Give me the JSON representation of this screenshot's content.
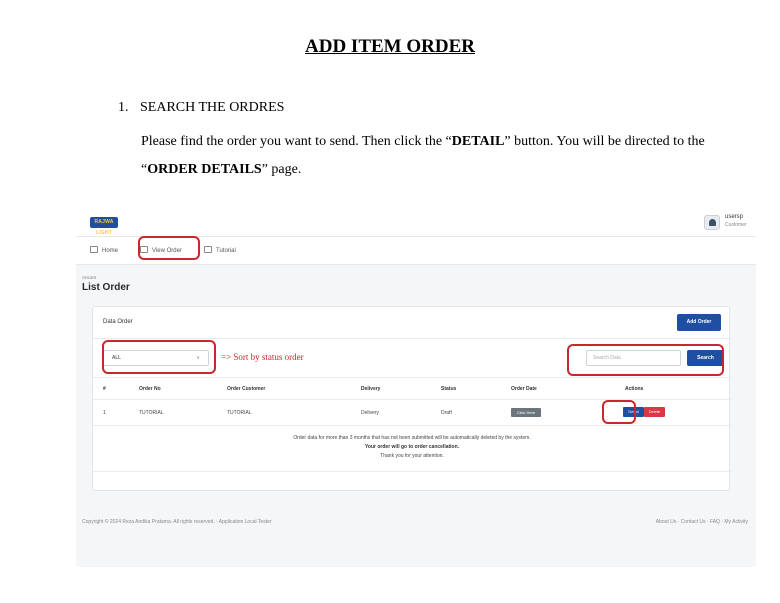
{
  "document": {
    "title": "ADD ITEM ORDER",
    "step_number": "1.",
    "step_heading": "SEARCH THE ORDRES",
    "instruction": {
      "part1": "Please find the order you want to send. Then click the “",
      "detail_word": "DETAIL",
      "part2": "” button. You will be directed to the “",
      "order_details_word": "ORDER DETAILS",
      "part3": "” page."
    }
  },
  "app": {
    "logo_text": "RAJWA LIGHT",
    "user": {
      "name": "usersp",
      "role": "Customer"
    },
    "nav": {
      "home": "Home",
      "view_order": "View Order",
      "tutorial": "Tutorial"
    },
    "breadcrumb": "ORDER",
    "page_title": "List Order",
    "card_title": "Data Order",
    "add_order_label": "Add Order",
    "status_filter": {
      "selected": "ALL"
    },
    "search": {
      "placeholder": "Search Data",
      "button": "Search"
    },
    "annotation_text": "=> Sort by status order",
    "table": {
      "headers": [
        "#",
        "Order No",
        "Order Customer",
        "Delivery",
        "Status",
        "Order Date",
        "Actions"
      ],
      "rows": [
        {
          "num": "1",
          "order_no": "TUTORIAL",
          "customer": "TUTORIAL",
          "delivery": "Delivery",
          "status": "Draft",
          "date_badge": "Click Here",
          "detail": "Detail",
          "delete": "Delete"
        }
      ]
    },
    "notice": {
      "line1": "Order data for more than 3 months that has not been submitted will be automatically deleted by the system.",
      "line2": "Your order will go to order cancellation.",
      "line3": "Thank you for your attention."
    },
    "footer": {
      "copyright": "Copyright © 2024 Reza Andika Pratama. All rights reserved. · Application Local Tester",
      "links": "About Us · Contact Us · FAQ · My Activity"
    }
  },
  "colors": {
    "primary": "#1f4fa3",
    "danger": "#dc3545",
    "annotation": "#c8272e",
    "badge": "#6c757d"
  }
}
